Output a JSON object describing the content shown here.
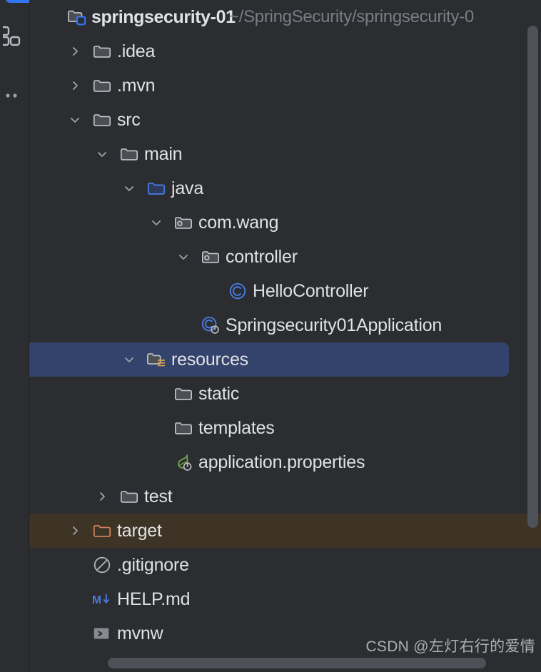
{
  "window": {
    "background_color": "#2b2d30",
    "selection_color": "#34436b",
    "excluded_color": "#3e3425",
    "accent_color": "#3574f0"
  },
  "left_strip": {
    "icons": [
      {
        "name": "project-structure-icon",
        "label": "Project"
      },
      {
        "name": "more-options-icon",
        "label": "More"
      }
    ]
  },
  "project": {
    "root": {
      "label": "springsecurity-01",
      "path": "~/SpringSecurity/springsecurity-0",
      "icon": "module-folder-icon",
      "expanded": true
    },
    "nodes": [
      {
        "label": ".idea",
        "icon": "folder-icon",
        "indent": 1,
        "arrow": "collapsed",
        "state": "normal"
      },
      {
        "label": ".mvn",
        "icon": "folder-icon",
        "indent": 1,
        "arrow": "collapsed",
        "state": "normal"
      },
      {
        "label": "src",
        "icon": "folder-icon",
        "indent": 1,
        "arrow": "expanded",
        "state": "normal"
      },
      {
        "label": "main",
        "icon": "folder-icon",
        "indent": 2,
        "arrow": "expanded",
        "state": "normal"
      },
      {
        "label": "java",
        "icon": "source-root-folder-icon",
        "indent": 3,
        "arrow": "expanded",
        "state": "normal"
      },
      {
        "label": "com.wang",
        "icon": "package-icon",
        "indent": 4,
        "arrow": "expanded",
        "state": "normal"
      },
      {
        "label": "controller",
        "icon": "package-icon",
        "indent": 5,
        "arrow": "expanded",
        "state": "normal"
      },
      {
        "label": "HelloController",
        "icon": "java-class-icon",
        "indent": 6,
        "arrow": "none",
        "state": "normal"
      },
      {
        "label": "Springsecurity01Application",
        "icon": "spring-boot-class-icon",
        "indent": 5,
        "arrow": "none",
        "state": "normal"
      },
      {
        "label": "resources",
        "icon": "resource-root-folder-icon",
        "indent": 3,
        "arrow": "expanded",
        "state": "selected"
      },
      {
        "label": "static",
        "icon": "folder-icon",
        "indent": 4,
        "arrow": "none",
        "state": "normal"
      },
      {
        "label": "templates",
        "icon": "folder-icon",
        "indent": 4,
        "arrow": "none",
        "state": "normal"
      },
      {
        "label": "application.properties",
        "icon": "spring-properties-icon",
        "indent": 4,
        "arrow": "none",
        "state": "normal"
      },
      {
        "label": "test",
        "icon": "folder-icon",
        "indent": 2,
        "arrow": "collapsed",
        "state": "normal"
      },
      {
        "label": "target",
        "icon": "excluded-folder-icon",
        "indent": 1,
        "arrow": "collapsed",
        "state": "excluded"
      },
      {
        "label": ".gitignore",
        "icon": "gitignore-icon",
        "indent": 1,
        "arrow": "none",
        "state": "normal"
      },
      {
        "label": "HELP.md",
        "icon": "markdown-icon",
        "indent": 1,
        "arrow": "none",
        "state": "normal"
      },
      {
        "label": "mvnw",
        "icon": "shell-script-icon",
        "indent": 1,
        "arrow": "none",
        "state": "normal"
      }
    ]
  },
  "scrollbars": {
    "vertical": {
      "name": "vertical-scrollbar"
    },
    "horizontal": {
      "name": "horizontal-scrollbar"
    }
  },
  "watermark": {
    "text": "CSDN @左灯右行的爱情"
  }
}
